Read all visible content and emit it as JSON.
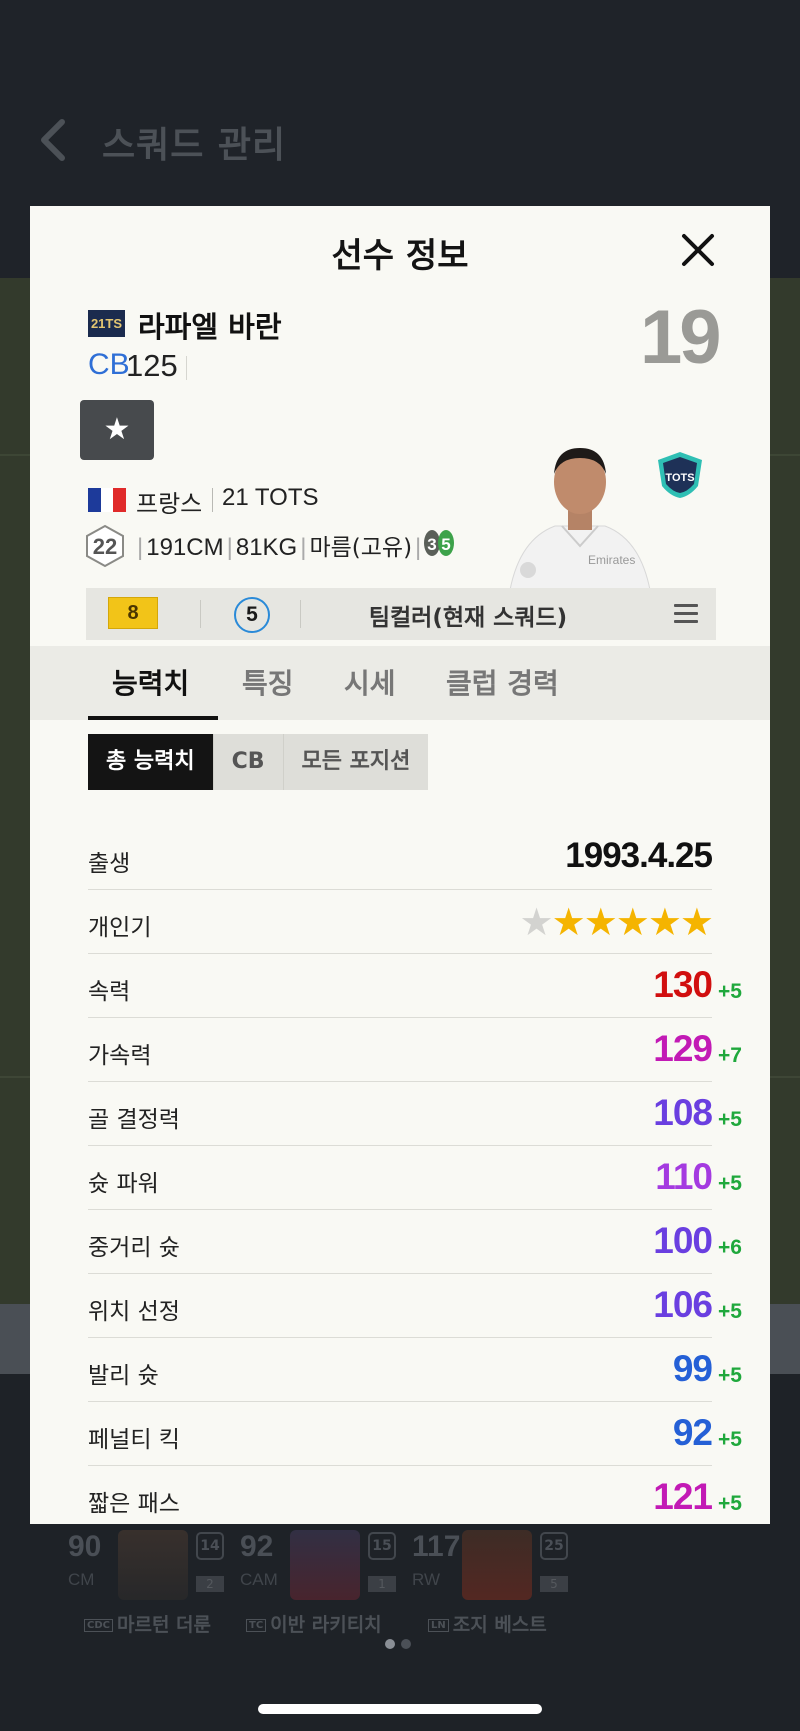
{
  "background": {
    "title": "스쿼드 관리",
    "bench": [
      {
        "ovr": "90",
        "pos": "CM",
        "level": "14",
        "sub": "2",
        "tag": "CDC",
        "name": "마르턴 더룬"
      },
      {
        "ovr": "92",
        "pos": "CAM",
        "level": "15",
        "sub": "1",
        "tag": "TC",
        "name": "이반 라키티치"
      },
      {
        "ovr": "117",
        "pos": "RW",
        "level": "25",
        "sub": "5",
        "tag": "LN",
        "name": "조지 베스트"
      }
    ]
  },
  "modal": {
    "title": "선수 정보",
    "player": {
      "season_badge": "21TS",
      "name": "라파엘 바란",
      "position": "CB",
      "ovr": "125",
      "number": "19",
      "nation": "프랑스",
      "club_season": "21 TOTS",
      "age": "22",
      "height": "191CM",
      "weight": "81KG",
      "body": "마름(고유)",
      "skill_moves": "3",
      "weak_foot": "5",
      "tots_badge": "TOTS"
    },
    "team_row": {
      "upgrade": "8",
      "color_level": "5",
      "label": "팀컬러(현재 스쿼드)"
    },
    "tabs": [
      "능력치",
      "특징",
      "시세",
      "클럽 경력"
    ],
    "subtabs": [
      "총 능력치",
      "CB",
      "모든 포지션"
    ],
    "birth": {
      "label": "출생",
      "value": "1993.4.25"
    },
    "popularity": {
      "label": "개인기",
      "stars_filled": 5,
      "stars_total": 6
    },
    "stats": [
      {
        "label": "속력",
        "value": "130",
        "plus": "+5",
        "color": "#d10f0f"
      },
      {
        "label": "가속력",
        "value": "129",
        "plus": "+7",
        "color": "#c21ab5"
      },
      {
        "label": "골 결정력",
        "value": "108",
        "plus": "+5",
        "color": "#6a3fe0"
      },
      {
        "label": "슛 파워",
        "value": "110",
        "plus": "+5",
        "color": "#a43ae0"
      },
      {
        "label": "중거리 슛",
        "value": "100",
        "plus": "+6",
        "color": "#6a3fe0"
      },
      {
        "label": "위치 선정",
        "value": "106",
        "plus": "+5",
        "color": "#6a3fe0"
      },
      {
        "label": "발리 슛",
        "value": "99",
        "plus": "+5",
        "color": "#2560d6"
      },
      {
        "label": "페널티 킥",
        "value": "92",
        "plus": "+5",
        "color": "#2560d6"
      },
      {
        "label": "짧은 패스",
        "value": "121",
        "plus": "+5",
        "color": "#c21ab5"
      }
    ],
    "colors": {
      "position": "#2f6fd6",
      "plus": "#1fa83c",
      "star": "#f5b400"
    }
  }
}
